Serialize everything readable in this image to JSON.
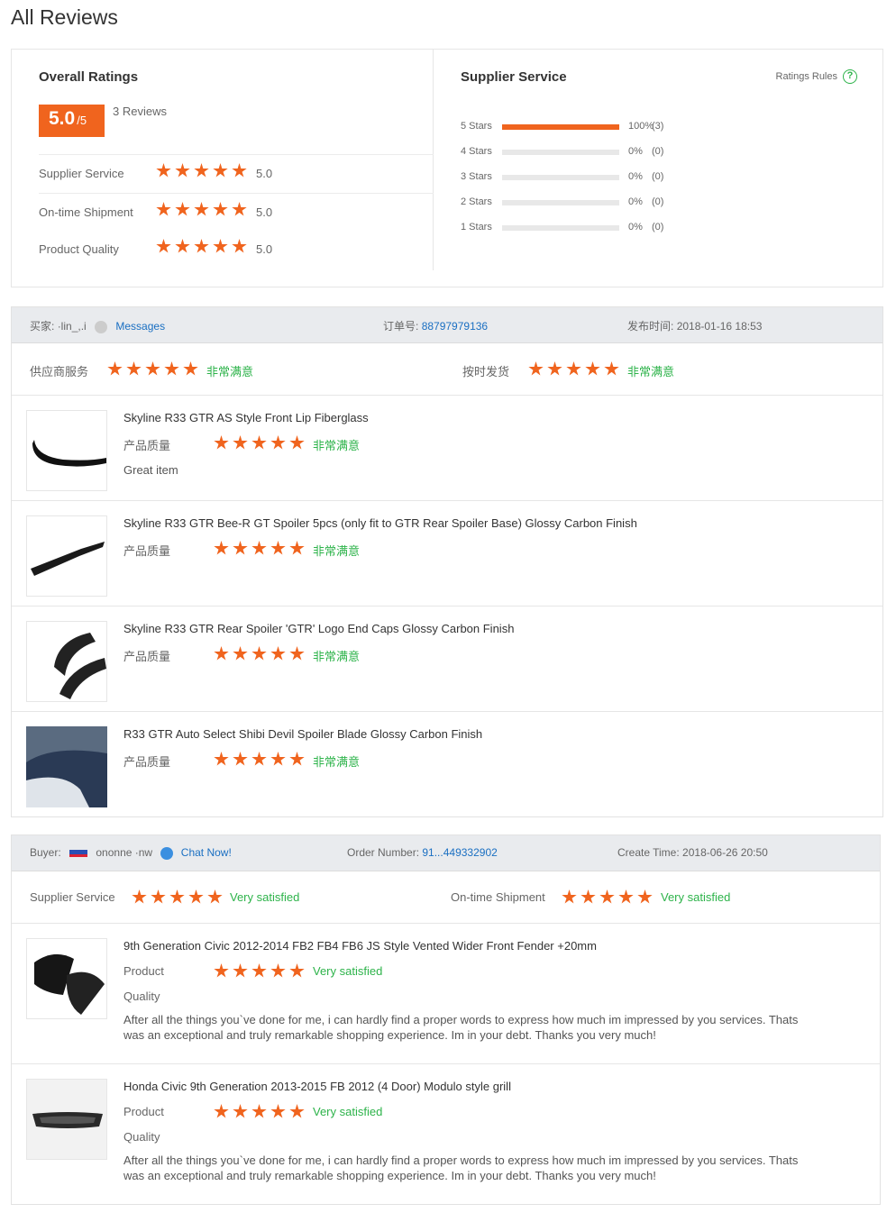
{
  "page_title": "All Reviews",
  "overall": {
    "heading": "Overall Ratings",
    "score": "5.0",
    "score_suffix": "/5",
    "review_count": "3 Reviews",
    "rows": [
      {
        "label": "Supplier Service",
        "value": "5.0"
      },
      {
        "label": "On-time Shipment",
        "value": "5.0"
      },
      {
        "label": "Product Quality",
        "value": "5.0"
      }
    ]
  },
  "supplier": {
    "heading": "Supplier Service",
    "rules_label": "Ratings Rules",
    "bars": [
      {
        "label": "5 Stars",
        "percent": "100%",
        "count": "(3)",
        "fill": 1.0
      },
      {
        "label": "4 Stars",
        "percent": "0%",
        "count": "(0)",
        "fill": 0
      },
      {
        "label": "3 Stars",
        "percent": "0%",
        "count": "(0)",
        "fill": 0
      },
      {
        "label": "2 Stars",
        "percent": "0%",
        "count": "(0)",
        "fill": 0
      },
      {
        "label": "1 Stars",
        "percent": "0%",
        "count": "(0)",
        "fill": 0
      }
    ]
  },
  "review1": {
    "buyer_label": "买家:",
    "buyer_name": "·lin_,.i",
    "message_link": "Messages",
    "order_label": "订单号:",
    "order_number": "88797979136",
    "time_label": "发布时间:",
    "time_value": "2018-01-16 18:53",
    "supplier_service_label": "供应商服务",
    "supplier_service_sat": "非常满意",
    "shipment_label": "按时发货",
    "shipment_sat": "非常满意",
    "items": [
      {
        "name": "Skyline R33 GTR AS Style Front Lip Fiberglass",
        "quality_label": "产品质量",
        "sat": "非常满意",
        "comment": "Great item"
      },
      {
        "name": "Skyline R33 GTR Bee-R GT Spoiler 5pcs (only fit to GTR Rear Spoiler Base) Glossy Carbon Finish",
        "quality_label": "产品质量",
        "sat": "非常满意"
      },
      {
        "name": "Skyline R33 GTR Rear Spoiler 'GTR' Logo End Caps Glossy Carbon Finish",
        "quality_label": "产品质量",
        "sat": "非常满意"
      },
      {
        "name": "R33 GTR Auto Select Shibi Devil Spoiler Blade Glossy Carbon Finish",
        "quality_label": "产品质量",
        "sat": "非常满意"
      }
    ]
  },
  "review2": {
    "buyer_label": "Buyer:",
    "buyer_name": "ononne ·nw",
    "chat_link": "Chat Now!",
    "order_label": "Order Number:",
    "order_number": "91...449332902",
    "time_label": "Create Time:",
    "time_value": "2018-06-26 20:50",
    "supplier_service_label": "Supplier Service",
    "supplier_service_sat": "Very satisfied",
    "shipment_label": "On-time Shipment",
    "shipment_sat": "Very satisfied",
    "items": [
      {
        "name": "9th Generation Civic 2012-2014 FB2 FB4 FB6 JS Style Vented Wider Front Fender +20mm",
        "quality_label_1": "Product",
        "quality_label_2": "Quality",
        "sat": "Very satisfied",
        "comment_1": "After all the things you`ve done for me, i can hardly find a proper words to express how much im impressed by you services. Thats",
        "comment_2": "was an exceptional and truly remarkable shopping experience. Im in your debt. Thanks you very much!"
      },
      {
        "name": "Honda Civic 9th Generation 2013-2015 FB 2012 (4 Door) Modulo style grill",
        "quality_label_1": "Product",
        "quality_label_2": "Quality",
        "sat": "Very satisfied",
        "comment_1": "After all the things you`ve done for me, i can hardly find a proper words to express how much im impressed by you services. Thats",
        "comment_2": "was an exceptional and truly remarkable shopping experience. Im in your debt. Thanks you very much!"
      }
    ]
  },
  "colors": {
    "accent": "#f0641e",
    "satisfied": "#2db34a",
    "link": "#1a6fc2"
  }
}
